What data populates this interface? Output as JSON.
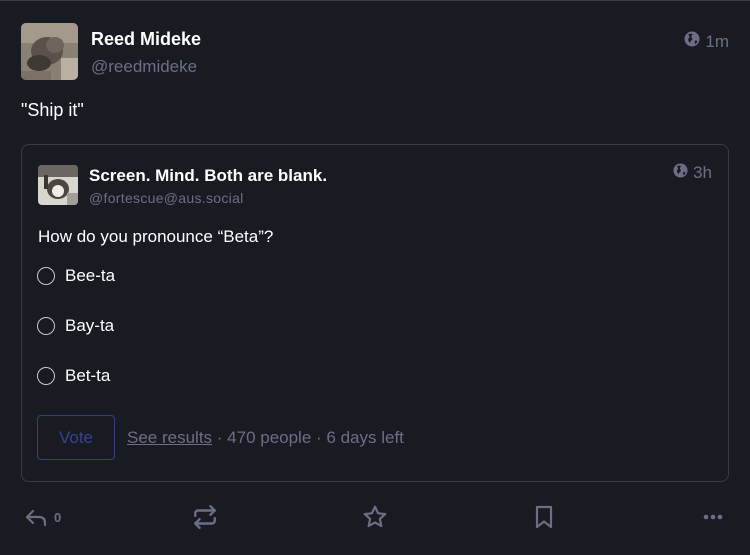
{
  "status": {
    "author": {
      "display_name": "Reed Mideke",
      "acct": "@reedmideke"
    },
    "visibility_icon": "globe-icon",
    "time": "1m",
    "content": "\"Ship it\""
  },
  "quote": {
    "author": {
      "display_name": "Screen. Mind. Both are blank.",
      "acct": "@fortescue@aus.social"
    },
    "visibility_icon": "globe-icon",
    "time": "3h",
    "text": "How do you pronounce “Beta”?",
    "poll": {
      "options": [
        {
          "label": "Bee-ta"
        },
        {
          "label": "Bay-ta"
        },
        {
          "label": "Bet-ta"
        }
      ],
      "vote_label": "Vote",
      "see_results_label": "See results",
      "sep1": " · ",
      "people": "470 people",
      "sep2": " · ",
      "time_left": "6 days left"
    }
  },
  "actions": {
    "reply_count": "0",
    "icons": [
      "reply-icon",
      "boost-icon",
      "favourite-icon",
      "bookmark-icon",
      "more-icon"
    ]
  }
}
